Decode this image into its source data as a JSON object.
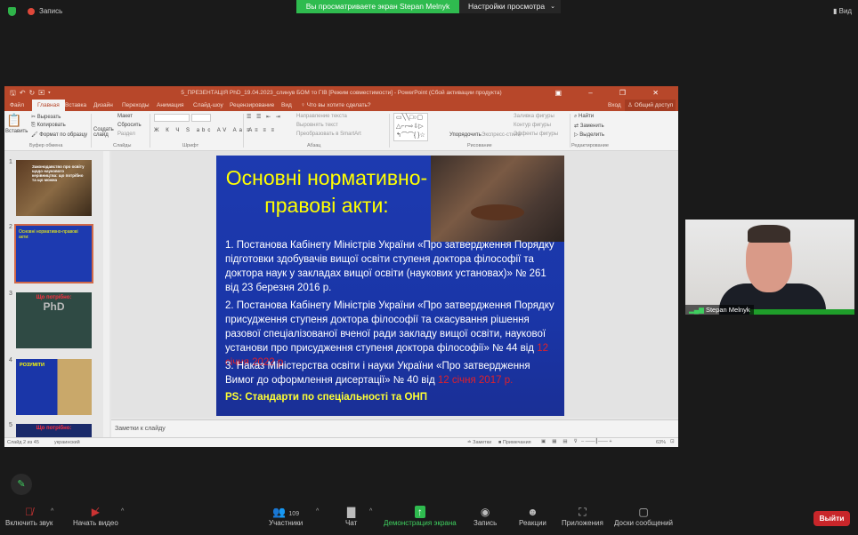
{
  "zoom": {
    "record_label": "Запись",
    "banner": "Вы просматриваете экран Stepan Melnyk",
    "view_settings": "Настройки просмотра",
    "view_label": "Вид",
    "toolbar": {
      "unmute": "Включить звук",
      "start_video": "Начать видео",
      "participants": "Участники",
      "participants_count": "109",
      "chat": "Чат",
      "share": "Демонстрация экрана",
      "record": "Запись",
      "reactions": "Реакции",
      "apps": "Приложения",
      "whiteboards": "Доски сообщений",
      "leave": "Выйти"
    },
    "video": {
      "name": "Stepan Melnyk"
    }
  },
  "ppt": {
    "title": "5_ПРЕЗЕНТАЦІЯ PhD_19.04.2023_слинув БОМ то ГІВ [Режим совместимости] - PowerPoint (Сбой активации продукта)",
    "tabs": [
      "Файл",
      "Главная",
      "Вставка",
      "Дизайн",
      "Переходы",
      "Анимация",
      "Слайд-шоу",
      "Рецензирование",
      "Вид",
      "Что вы хотите сделать?"
    ],
    "signin": "Вход",
    "share": "Общий доступ",
    "ribbon": {
      "paste": "Вставить",
      "cut": "Вырезать",
      "copy": "Копировать",
      "format_painter": "Формат по образцу",
      "clipboard": "Буфер обмена",
      "new_slide": "Создать слайд",
      "layout": "Макет",
      "reset": "Сбросить",
      "section": "Раздел",
      "slides": "Слайды",
      "font": "Шрифт",
      "text_direction": "Направление текста",
      "align_text": "Выровнять текст",
      "smartart": "Преобразовать в SmartArt",
      "paragraph": "Абзац",
      "arrange": "Упорядочить",
      "quick_styles": "Экспресс-стили",
      "shape_fill": "Заливка фигуры",
      "shape_outline": "Контур фигуры",
      "shape_effects": "Эффекты фигуры",
      "drawing": "Рисование",
      "find": "Найти",
      "replace": "Заменить",
      "select": "Выделить",
      "editing": "Редактирование"
    },
    "thumbnails": [
      {
        "num": "1",
        "text": "Законодавство про освіту щодо наукового керівництва: що потрібно та що можна"
      },
      {
        "num": "2",
        "text": "Основні нормативно-правові акти:"
      },
      {
        "num": "3",
        "text": "Що потрібно:",
        "sub": "PhD"
      },
      {
        "num": "4",
        "text": "РОЗУМІТИ"
      },
      {
        "num": "5",
        "text": "Що потрібно:"
      }
    ],
    "slide": {
      "title": "Основні нормативно-правові акти:",
      "items": [
        {
          "text": "1.  Постанова Кабінету Міністрів України «Про затвердження Порядку підготовки здобувачів вищої освіти ступеня доктора філософії та доктора наук у закладах вищої освіти (наукових установах)» № 261 від 23 березня 2016 р.",
          "date": ""
        },
        {
          "text": "2.  Постанова Кабінету Міністрів України «Про затвердження Порядку присудження ступеня доктора філософії та скасування рішення разової спеціалізованої вченої ради закладу вищої освіти, наукової установи про присудження ступеня доктора філософії» № 44 від ",
          "date": "12 січня 2022 р."
        },
        {
          "text": "3.  Наказ Міністерства освіти і науки України «Про затвердження Вимог до оформлення дисертації» № 40 від ",
          "date": "12 січня 2017 р."
        }
      ],
      "ps": "PS: Стандарти по спеціальності та ОНП"
    },
    "notes_placeholder": "Заметки к слайду",
    "status": {
      "slide_of": "Слайд 2 из 45",
      "language": "украинский",
      "notes": "Заметки",
      "comments": "Примечания",
      "zoom": "63%"
    }
  }
}
